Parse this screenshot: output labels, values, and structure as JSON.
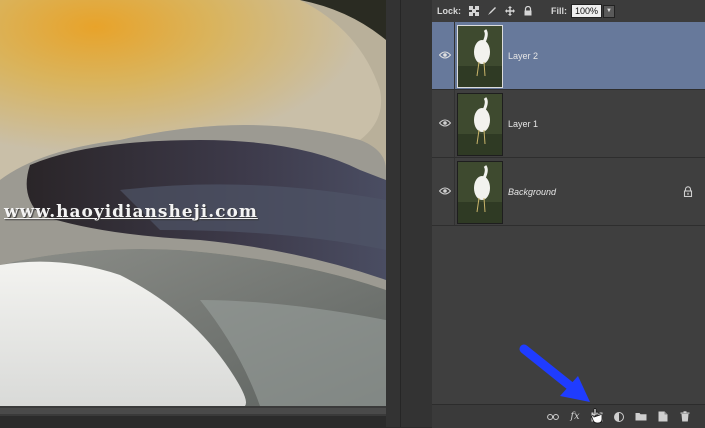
{
  "watermark": "www.haoyidiansheji.com",
  "lock_bar": {
    "lock_label": "Lock:",
    "fill_label": "Fill:",
    "fill_value": "100%"
  },
  "layers": [
    {
      "name": "Layer 2",
      "selected": true,
      "locked": false,
      "italic": false
    },
    {
      "name": "Layer 1",
      "selected": false,
      "locked": false,
      "italic": false
    },
    {
      "name": "Background",
      "selected": false,
      "locked": true,
      "italic": true
    }
  ],
  "footer_buttons": [
    {
      "id": "link-layers",
      "icon": "link-icon",
      "label": "⇔"
    },
    {
      "id": "add-style",
      "icon": "fx-icon",
      "label": "fx"
    },
    {
      "id": "add-mask",
      "icon": "layer-mask-icon",
      "label": ""
    },
    {
      "id": "adjustment",
      "icon": "adjustment-layer-icon",
      "label": ""
    },
    {
      "id": "group",
      "icon": "folder-icon",
      "label": ""
    },
    {
      "id": "new-layer",
      "icon": "new-layer-icon",
      "label": ""
    },
    {
      "id": "delete",
      "icon": "trash-icon",
      "label": ""
    }
  ],
  "colors": {
    "selected_layer": "#67799b",
    "annotation_arrow": "#1f3cff"
  }
}
